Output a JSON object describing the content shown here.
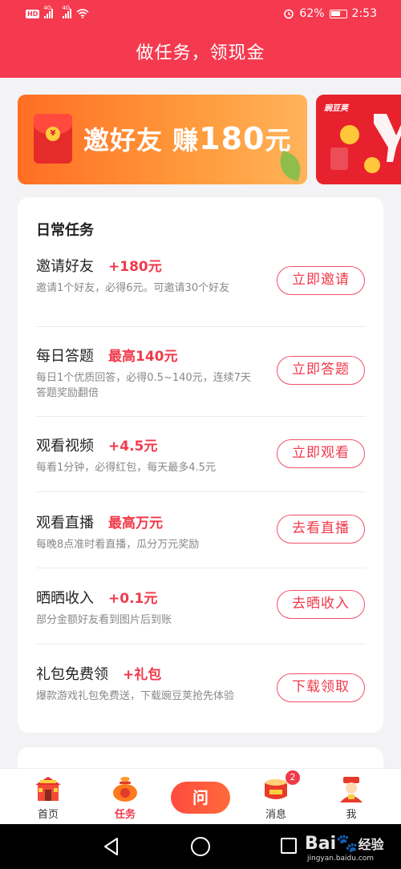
{
  "status_bar": {
    "network_badge": "HD",
    "signal1": "4G",
    "signal2": "4G",
    "battery": "62%",
    "time": "2:53"
  },
  "header": {
    "title": "做任务，领现金"
  },
  "banner": {
    "text": "邀好友 赚",
    "amount": "180",
    "unit": "元"
  },
  "banner2": {
    "brand": "豌豆荚"
  },
  "daily": {
    "title": "日常任务",
    "tasks": [
      {
        "name": "邀请好友",
        "reward": "+180元",
        "desc": "邀请1个好友，必得6元。可邀请30个好友",
        "button": "立即邀请"
      },
      {
        "name": "每日答题",
        "reward": "最高140元",
        "desc": "每日1个优质回答，必得0.5~140元，连续7天答题奖励翻倍",
        "button": "立即答题"
      },
      {
        "name": "观看视频",
        "reward": "+4.5元",
        "desc": "每看1分钟，必得红包，每天最多4.5元",
        "button": "立即观看"
      },
      {
        "name": "观看直播",
        "reward": "最高万元",
        "desc": "每晚8点准时看直播，瓜分万元奖励",
        "button": "去看直播"
      },
      {
        "name": "晒晒收入",
        "reward": "+0.1元",
        "desc": "部分金额好友看到图片后到账",
        "button": "去晒收入"
      },
      {
        "name": "礼包免费领",
        "reward": "+礼包",
        "desc": "爆款游戏礼包免费送，下载豌豆荚抢先体验",
        "button": "下载领取"
      }
    ]
  },
  "bottom_nav": {
    "home": "首页",
    "tasks": "任务",
    "ask": "问",
    "messages": "消息",
    "messages_badge": "2",
    "me": "我"
  },
  "watermark": {
    "text": "Bai",
    "suffix": "经验",
    "url": "jingyan.baidu.com"
  },
  "colors": {
    "accent": "#f5394f",
    "reward": "#f03a4c",
    "banner": "#ff7a2a"
  }
}
